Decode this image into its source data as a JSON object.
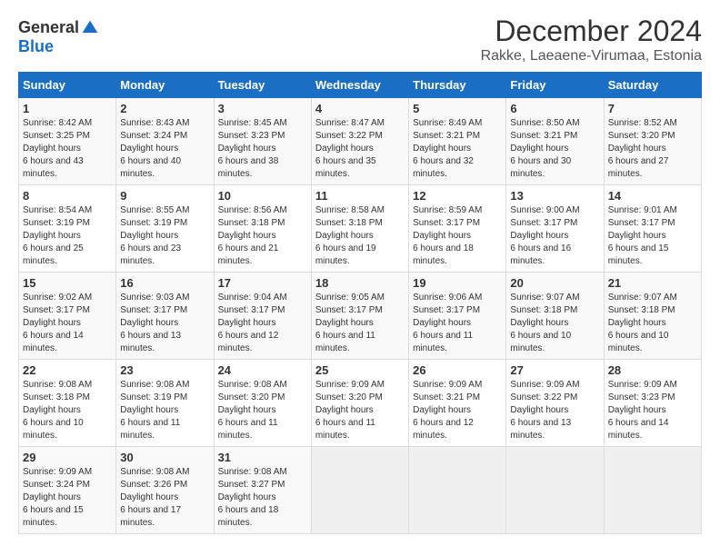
{
  "logo": {
    "general": "General",
    "blue": "Blue"
  },
  "title": "December 2024",
  "subtitle": "Rakke, Laeaene-Virumaa, Estonia",
  "days_of_week": [
    "Sunday",
    "Monday",
    "Tuesday",
    "Wednesday",
    "Thursday",
    "Friday",
    "Saturday"
  ],
  "weeks": [
    [
      {
        "day": "1",
        "sunrise": "8:42 AM",
        "sunset": "3:25 PM",
        "daylight": "6 hours and 43 minutes."
      },
      {
        "day": "2",
        "sunrise": "8:43 AM",
        "sunset": "3:24 PM",
        "daylight": "6 hours and 40 minutes."
      },
      {
        "day": "3",
        "sunrise": "8:45 AM",
        "sunset": "3:23 PM",
        "daylight": "6 hours and 38 minutes."
      },
      {
        "day": "4",
        "sunrise": "8:47 AM",
        "sunset": "3:22 PM",
        "daylight": "6 hours and 35 minutes."
      },
      {
        "day": "5",
        "sunrise": "8:49 AM",
        "sunset": "3:21 PM",
        "daylight": "6 hours and 32 minutes."
      },
      {
        "day": "6",
        "sunrise": "8:50 AM",
        "sunset": "3:21 PM",
        "daylight": "6 hours and 30 minutes."
      },
      {
        "day": "7",
        "sunrise": "8:52 AM",
        "sunset": "3:20 PM",
        "daylight": "6 hours and 27 minutes."
      }
    ],
    [
      {
        "day": "8",
        "sunrise": "8:54 AM",
        "sunset": "3:19 PM",
        "daylight": "6 hours and 25 minutes."
      },
      {
        "day": "9",
        "sunrise": "8:55 AM",
        "sunset": "3:19 PM",
        "daylight": "6 hours and 23 minutes."
      },
      {
        "day": "10",
        "sunrise": "8:56 AM",
        "sunset": "3:18 PM",
        "daylight": "6 hours and 21 minutes."
      },
      {
        "day": "11",
        "sunrise": "8:58 AM",
        "sunset": "3:18 PM",
        "daylight": "6 hours and 19 minutes."
      },
      {
        "day": "12",
        "sunrise": "8:59 AM",
        "sunset": "3:17 PM",
        "daylight": "6 hours and 18 minutes."
      },
      {
        "day": "13",
        "sunrise": "9:00 AM",
        "sunset": "3:17 PM",
        "daylight": "6 hours and 16 minutes."
      },
      {
        "day": "14",
        "sunrise": "9:01 AM",
        "sunset": "3:17 PM",
        "daylight": "6 hours and 15 minutes."
      }
    ],
    [
      {
        "day": "15",
        "sunrise": "9:02 AM",
        "sunset": "3:17 PM",
        "daylight": "6 hours and 14 minutes."
      },
      {
        "day": "16",
        "sunrise": "9:03 AM",
        "sunset": "3:17 PM",
        "daylight": "6 hours and 13 minutes."
      },
      {
        "day": "17",
        "sunrise": "9:04 AM",
        "sunset": "3:17 PM",
        "daylight": "6 hours and 12 minutes."
      },
      {
        "day": "18",
        "sunrise": "9:05 AM",
        "sunset": "3:17 PM",
        "daylight": "6 hours and 11 minutes."
      },
      {
        "day": "19",
        "sunrise": "9:06 AM",
        "sunset": "3:17 PM",
        "daylight": "6 hours and 11 minutes."
      },
      {
        "day": "20",
        "sunrise": "9:07 AM",
        "sunset": "3:18 PM",
        "daylight": "6 hours and 10 minutes."
      },
      {
        "day": "21",
        "sunrise": "9:07 AM",
        "sunset": "3:18 PM",
        "daylight": "6 hours and 10 minutes."
      }
    ],
    [
      {
        "day": "22",
        "sunrise": "9:08 AM",
        "sunset": "3:18 PM",
        "daylight": "6 hours and 10 minutes."
      },
      {
        "day": "23",
        "sunrise": "9:08 AM",
        "sunset": "3:19 PM",
        "daylight": "6 hours and 11 minutes."
      },
      {
        "day": "24",
        "sunrise": "9:08 AM",
        "sunset": "3:20 PM",
        "daylight": "6 hours and 11 minutes."
      },
      {
        "day": "25",
        "sunrise": "9:09 AM",
        "sunset": "3:20 PM",
        "daylight": "6 hours and 11 minutes."
      },
      {
        "day": "26",
        "sunrise": "9:09 AM",
        "sunset": "3:21 PM",
        "daylight": "6 hours and 12 minutes."
      },
      {
        "day": "27",
        "sunrise": "9:09 AM",
        "sunset": "3:22 PM",
        "daylight": "6 hours and 13 minutes."
      },
      {
        "day": "28",
        "sunrise": "9:09 AM",
        "sunset": "3:23 PM",
        "daylight": "6 hours and 14 minutes."
      }
    ],
    [
      {
        "day": "29",
        "sunrise": "9:09 AM",
        "sunset": "3:24 PM",
        "daylight": "6 hours and 15 minutes."
      },
      {
        "day": "30",
        "sunrise": "9:08 AM",
        "sunset": "3:26 PM",
        "daylight": "6 hours and 17 minutes."
      },
      {
        "day": "31",
        "sunrise": "9:08 AM",
        "sunset": "3:27 PM",
        "daylight": "6 hours and 18 minutes."
      },
      null,
      null,
      null,
      null
    ]
  ]
}
